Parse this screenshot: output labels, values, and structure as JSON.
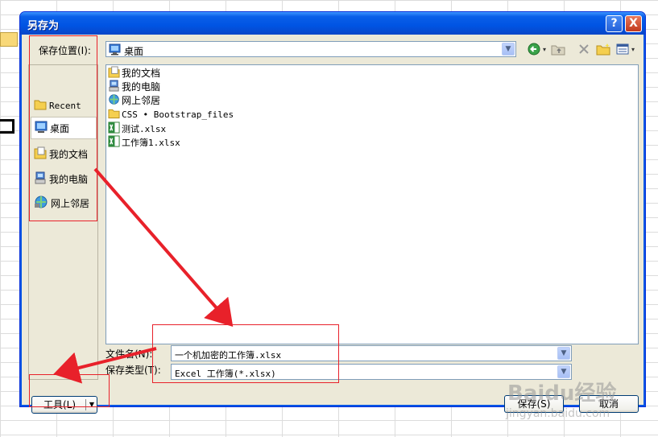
{
  "dialog": {
    "title": "另存为",
    "help_button": "?",
    "close_button": "X"
  },
  "location": {
    "label": "保存位置(I):",
    "value": "桌面"
  },
  "toolbar": {
    "icons": [
      "back-icon",
      "up-folder-icon",
      "delete-icon",
      "new-folder-icon",
      "views-icon"
    ]
  },
  "places": [
    {
      "label": "Recent",
      "icon": "folder-icon"
    },
    {
      "label": "桌面",
      "icon": "desktop-icon",
      "selected": true
    },
    {
      "label": "我的文档",
      "icon": "documents-icon"
    },
    {
      "label": "我的电脑",
      "icon": "computer-icon"
    },
    {
      "label": "网上邻居",
      "icon": "network-icon"
    }
  ],
  "files": [
    {
      "name": "我的文档",
      "icon": "documents-icon"
    },
    {
      "name": "我的电脑",
      "icon": "computer-icon"
    },
    {
      "name": "网上邻居",
      "icon": "network-icon"
    },
    {
      "name": "CSS • Bootstrap_files",
      "icon": "folder-icon"
    },
    {
      "name": "测试.xlsx",
      "icon": "excel-icon"
    },
    {
      "name": "工作簿1.xlsx",
      "icon": "excel-icon"
    }
  ],
  "filename": {
    "label": "文件名(N):",
    "value": "一个机加密的工作簿.xlsx"
  },
  "filetype": {
    "label": "保存类型(T):",
    "value": "Excel 工作簿(*.xlsx)"
  },
  "buttons": {
    "tools": "工具(L)",
    "save": "保存(S)",
    "cancel": "取消"
  },
  "watermark": {
    "line1": "Baidu经验",
    "line2": "jingyan.baidu.com"
  },
  "colors": {
    "annotation": "#e8212a",
    "title_bar": "#0054e3",
    "dialog_bg": "#ece9d8"
  }
}
